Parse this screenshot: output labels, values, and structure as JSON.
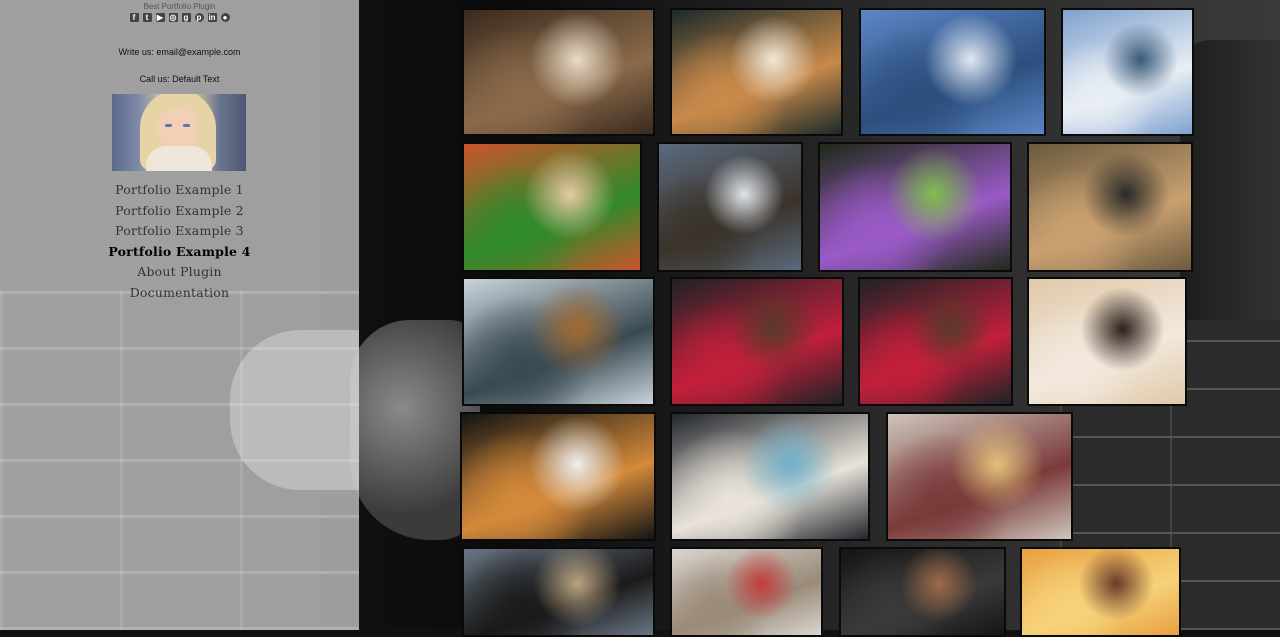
{
  "sidebar": {
    "site_title": "Best Portfolio Plugin",
    "social_icons": [
      "facebook-icon",
      "twitter-icon",
      "youtube-icon",
      "instagram-icon",
      "google-plus-icon",
      "pinterest-icon",
      "linkedin-icon",
      "github-icon"
    ],
    "write_us": "Write us: email@example.com",
    "call_us": "Call us: Default Text",
    "menu": [
      {
        "label": "Portfolio Example 1",
        "active": false
      },
      {
        "label": "Portfolio Example 2",
        "active": false
      },
      {
        "label": "Portfolio Example 3",
        "active": false
      },
      {
        "label": "Portfolio Example 4",
        "active": true
      },
      {
        "label": "About Plugin",
        "active": false
      },
      {
        "label": "Documentation",
        "active": false
      }
    ]
  },
  "gallery": {
    "items": [
      {
        "name": "photo-asian-food",
        "colors": [
          "#3a2a1f",
          "#8a6a4a",
          "#e8dcc8"
        ]
      },
      {
        "name": "photo-coffee-cup",
        "colors": [
          "#1b2a2a",
          "#c98a4a",
          "#f1e7d6"
        ]
      },
      {
        "name": "photo-lake-mountains",
        "colors": [
          "#5d86c6",
          "#2c4f7e",
          "#dfe8f2"
        ]
      },
      {
        "name": "photo-snow-valley",
        "colors": [
          "#7fa1cf",
          "#e9eef4",
          "#3a5a78"
        ]
      },
      {
        "name": "photo-vegetables",
        "colors": [
          "#c9552c",
          "#2f8a2a",
          "#e6c9a3"
        ]
      },
      {
        "name": "photo-hiker-mountain",
        "colors": [
          "#5b6a7d",
          "#3a332a",
          "#dfe3ea"
        ]
      },
      {
        "name": "photo-color-powder",
        "colors": [
          "#1e2a16",
          "#9a5ac8",
          "#7fbf4a"
        ]
      },
      {
        "name": "photo-woman-door",
        "colors": [
          "#6a5a3f",
          "#c9a070",
          "#2a2a2a"
        ]
      },
      {
        "name": "photo-pier-lake",
        "colors": [
          "#c9d4dc",
          "#3a4a52",
          "#a0692f"
        ]
      },
      {
        "name": "photo-chocolate-raspberry-1",
        "colors": [
          "#1e2326",
          "#c21f3a",
          "#5a3a2a"
        ]
      },
      {
        "name": "photo-chocolate-raspberry-2",
        "colors": [
          "#1e2326",
          "#c21f3a",
          "#5a3a2a"
        ]
      },
      {
        "name": "photo-woman-pillows",
        "colors": [
          "#e0c9a8",
          "#f2e8dc",
          "#2a1f1a"
        ]
      },
      {
        "name": "photo-croissant-coffee",
        "colors": [
          "#141414",
          "#d48a3a",
          "#eeeeee"
        ]
      },
      {
        "name": "photo-breakfast-newspaper",
        "colors": [
          "#22262c",
          "#e9e3da",
          "#6fb0c9"
        ]
      },
      {
        "name": "photo-woman-book",
        "colors": [
          "#cfc6bb",
          "#7a3a3a",
          "#e3c07a"
        ]
      },
      {
        "name": "photo-car-mirror",
        "colors": [
          "#6a7686",
          "#1a1a1a",
          "#b9a380"
        ]
      },
      {
        "name": "photo-woman-gym",
        "colors": [
          "#d9d5cf",
          "#9a8a78",
          "#c23a3a"
        ]
      },
      {
        "name": "photo-man-dark",
        "colors": [
          "#151515",
          "#3a3a3a",
          "#a06a4a"
        ]
      },
      {
        "name": "photo-sunset-hiker",
        "colors": [
          "#e8a040",
          "#f6d27a",
          "#6a3a2a"
        ]
      }
    ]
  }
}
